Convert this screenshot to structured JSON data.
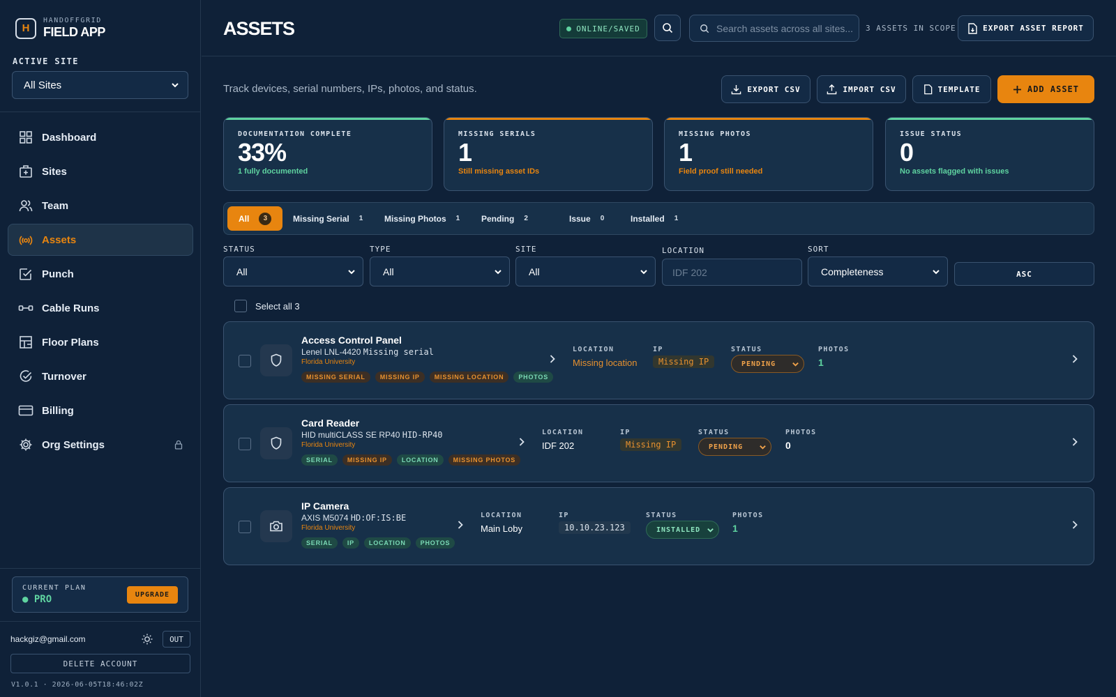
{
  "sidebar": {
    "brand_sub": "HANDOFFGRID",
    "brand_name": "FIELD APP",
    "active_site_label": "ACTIVE SITE",
    "active_site_value": "All Sites",
    "items": [
      {
        "label": "Dashboard",
        "icon": "grid-icon"
      },
      {
        "label": "Sites",
        "icon": "building-icon"
      },
      {
        "label": "Team",
        "icon": "users-icon"
      },
      {
        "label": "Assets",
        "icon": "assets-icon",
        "active": true
      },
      {
        "label": "Punch",
        "icon": "checkbox-icon"
      },
      {
        "label": "Cable Runs",
        "icon": "cable-icon"
      },
      {
        "label": "Floor Plans",
        "icon": "floorplan-icon"
      },
      {
        "label": "Turnover",
        "icon": "check-circle-icon"
      },
      {
        "label": "Billing",
        "icon": "card-icon"
      },
      {
        "label": "Org Settings",
        "icon": "gear-icon",
        "locked": true
      }
    ],
    "plan_label": "CURRENT PLAN",
    "plan_value": "● PRO",
    "upgrade_label": "UPGRADE",
    "user_email": "hackgiz@gmail.com",
    "out_label": "OUT",
    "delete_label": "DELETE ACCOUNT",
    "version": "V1.0.1 · 2026-06-05T18:46:02Z"
  },
  "header": {
    "title": "ASSETS",
    "status": "ONLINE/SAVED",
    "search_placeholder": "Search assets across all sites...",
    "scope": "3 ASSETS IN SCOPE",
    "export_report": "EXPORT ASSET REPORT"
  },
  "toolbar": {
    "subtitle": "Track devices, serial numbers, IPs, photos, and status.",
    "export_csv": "EXPORT CSV",
    "import_csv": "IMPORT CSV",
    "template": "TEMPLATE",
    "add_asset": "ADD ASSET"
  },
  "cards": [
    {
      "label": "DOCUMENTATION COMPLETE",
      "value": "33%",
      "sub": "1 fully documented",
      "color": "#5fd3a0"
    },
    {
      "label": "MISSING SERIALS",
      "value": "1",
      "sub": "Still missing asset IDs",
      "color": "#e8850f"
    },
    {
      "label": "MISSING PHOTOS",
      "value": "1",
      "sub": "Field proof still needed",
      "color": "#e8850f"
    },
    {
      "label": "ISSUE STATUS",
      "value": "0",
      "sub": "No assets flagged with issues",
      "color": "#5fd3a0"
    }
  ],
  "filters": [
    {
      "label": "All",
      "count": "3"
    },
    {
      "label": "Missing Serial",
      "count": "1"
    },
    {
      "label": "Missing Photos",
      "count": "1"
    },
    {
      "label": "Pending",
      "count": "2"
    },
    {
      "label": "Issue",
      "count": "0"
    },
    {
      "label": "Installed",
      "count": "1"
    }
  ],
  "selects": {
    "status_label": "STATUS",
    "status_value": "All",
    "type_label": "TYPE",
    "type_value": "All",
    "site_label": "SITE",
    "site_value": "All",
    "location_label": "LOCATION",
    "location_placeholder": "IDF 202",
    "sort_label": "SORT",
    "sort_value": "Completeness",
    "asc_label": "ASC"
  },
  "select_all": "Select all 3",
  "columns": {
    "location": "LOCATION",
    "ip": "IP",
    "status": "STATUS",
    "photos": "PHOTOS"
  },
  "assets": [
    {
      "name": "Access Control Panel",
      "model": "Lenel LNL-4420",
      "serial": "Missing serial",
      "site": "Florida University",
      "icon": "shield-icon",
      "tags": [
        {
          "label": "MISSING SERIAL",
          "ok": false
        },
        {
          "label": "MISSING IP",
          "ok": false
        },
        {
          "label": "MISSING LOCATION",
          "ok": false
        },
        {
          "label": "PHOTOS",
          "ok": true
        }
      ],
      "location": "Missing location",
      "location_missing": true,
      "ip": "Missing IP",
      "ip_missing": true,
      "status": "PENDING",
      "photos": "1"
    },
    {
      "name": "Card Reader",
      "model": "HID multiCLASS SE RP40",
      "serial": "HID-RP40",
      "site": "Florida University",
      "icon": "shield-icon",
      "tags": [
        {
          "label": "SERIAL",
          "ok": true
        },
        {
          "label": "MISSING IP",
          "ok": false
        },
        {
          "label": "LOCATION",
          "ok": true
        },
        {
          "label": "MISSING PHOTOS",
          "ok": false
        }
      ],
      "location": "IDF 202",
      "location_missing": false,
      "ip": "Missing IP",
      "ip_missing": true,
      "status": "PENDING",
      "photos": "0"
    },
    {
      "name": "IP Camera",
      "model": "AXIS M5074",
      "serial": "HD:OF:IS:BE",
      "site": "Florida University",
      "icon": "camera-icon",
      "tags": [
        {
          "label": "SERIAL",
          "ok": true
        },
        {
          "label": "IP",
          "ok": true
        },
        {
          "label": "LOCATION",
          "ok": true
        },
        {
          "label": "PHOTOS",
          "ok": true
        }
      ],
      "location": "Main Loby",
      "location_missing": false,
      "ip": "10.10.23.123",
      "ip_missing": false,
      "status": "INSTALLED",
      "photos": "1"
    }
  ]
}
